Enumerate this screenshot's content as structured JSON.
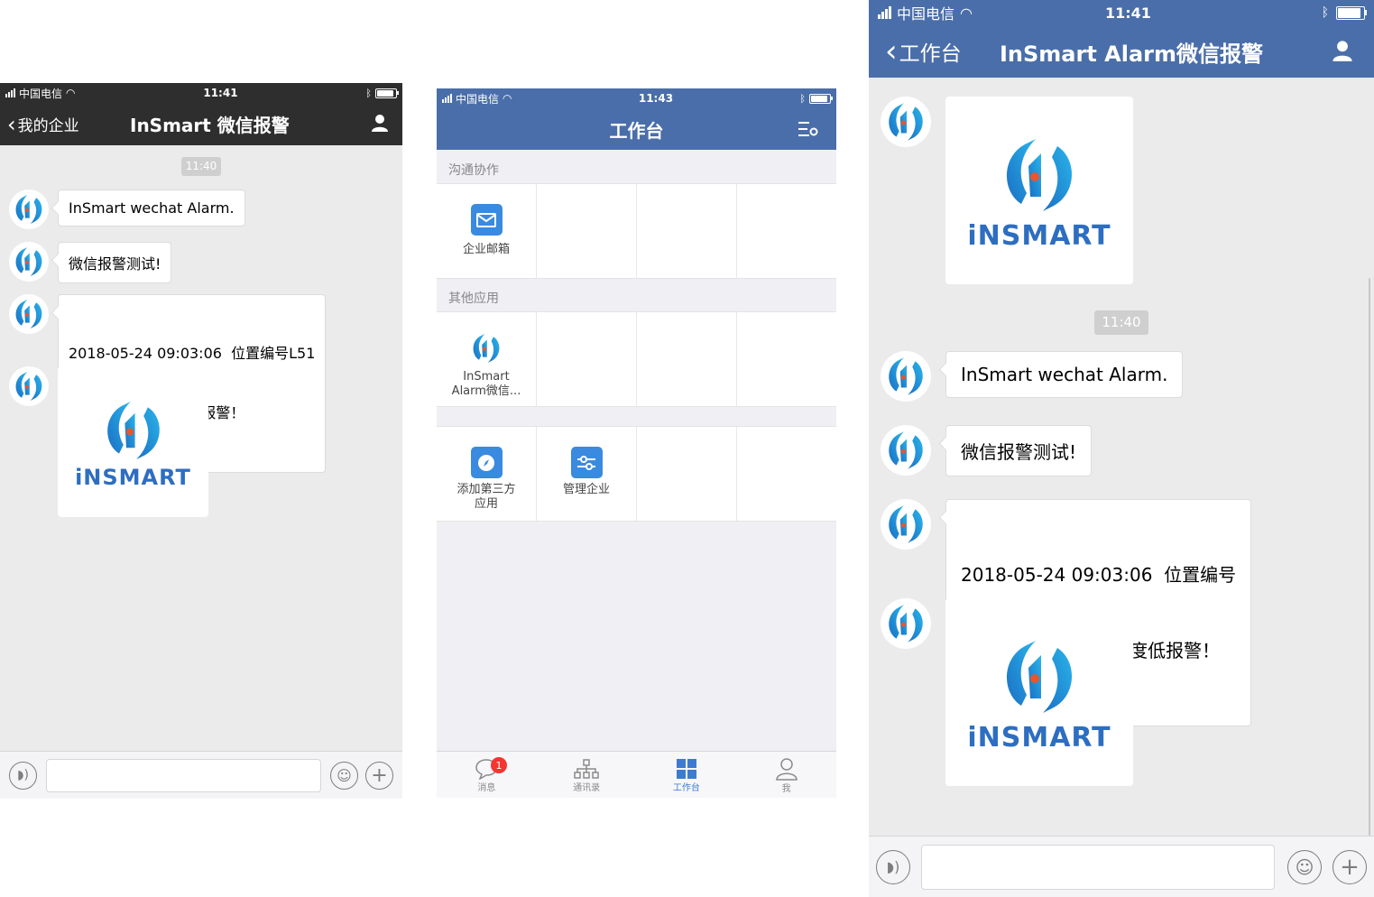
{
  "screens": {
    "left": {
      "status": {
        "carrier": "中国电信",
        "time": "11:41"
      },
      "nav": {
        "back_label": "我的企业",
        "title": "InSmart 微信报警"
      },
      "timestamp": "11:40",
      "messages": [
        {
          "type": "text",
          "text": "InSmart wechat Alarm."
        },
        {
          "type": "text",
          "text": "微信报警测试!"
        },
        {
          "type": "text",
          "line1": "2018-05-24 09:03:06  位置编号L51",
          "line2": "  SC001_L51温度低报警！"
        },
        {
          "type": "image",
          "logo_text": "iNSMART"
        }
      ]
    },
    "middle": {
      "status": {
        "carrier": "中国电信",
        "time": "11:43"
      },
      "nav": {
        "title": "工作台"
      },
      "sections": [
        {
          "title": "沟通协作",
          "apps": [
            {
              "label": "企业邮箱",
              "icon": "mail-icon"
            }
          ]
        },
        {
          "title": "其他应用",
          "apps": [
            {
              "label": "InSmart Alarm微信...",
              "line1": "InSmart",
              "line2": "Alarm微信...",
              "icon": "insmart-logo"
            }
          ]
        },
        {
          "title": "",
          "apps": [
            {
              "label": "添加第三方应用",
              "line1": "添加第三方",
              "line2": "应用",
              "icon": "compass-icon"
            },
            {
              "label": "管理企业",
              "icon": "sliders-icon"
            }
          ]
        }
      ],
      "tabs": [
        {
          "label": "消息",
          "icon": "chat-bubble-icon",
          "badge": "1"
        },
        {
          "label": "通讯录",
          "icon": "org-chart-icon"
        },
        {
          "label": "工作台",
          "icon": "grid-icon",
          "active": true
        },
        {
          "label": "我",
          "icon": "person-icon"
        }
      ]
    },
    "right": {
      "status": {
        "carrier": "中国电信",
        "time": "11:41"
      },
      "nav": {
        "back_label": "工作台",
        "title": "InSmart Alarm微信报警"
      },
      "timestamp": "11:40",
      "messages": [
        {
          "type": "image",
          "logo_text": "iNSMART"
        },
        {
          "type": "text",
          "text": "InSmart wechat Alarm."
        },
        {
          "type": "text",
          "text": "微信报警测试!"
        },
        {
          "type": "text",
          "line1": "2018-05-24 09:03:06  位置编号",
          "line2": "L51   SC001_L51温度低报警！"
        },
        {
          "type": "image",
          "logo_text": "iNSMART"
        }
      ]
    }
  },
  "colors": {
    "dark_nav": "#2e2e2e",
    "wecom_blue": "#4a6ea9",
    "chat_bg": "#ebebeb",
    "active_tab": "#3d7bd0",
    "logo_blue": "#2d6ec1"
  }
}
